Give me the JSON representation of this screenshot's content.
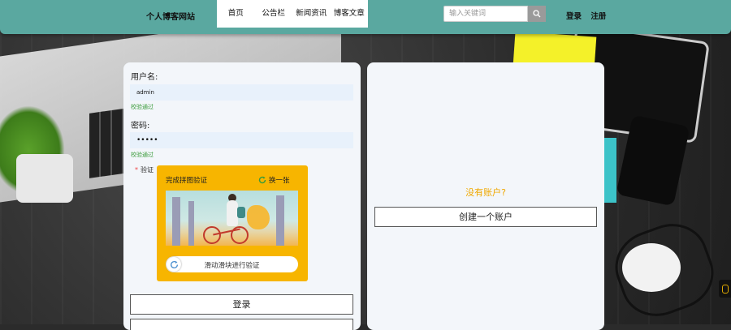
{
  "header": {
    "brand": "个人博客网站",
    "nav": [
      "首页",
      "公告栏",
      "新闻资讯",
      "博客文章"
    ],
    "search": {
      "placeholder": "输入关键词",
      "value": ""
    },
    "auth": {
      "login": "登录",
      "register": "注册"
    }
  },
  "login_form": {
    "username_label": "用户名:",
    "username_value": "admin",
    "username_hint": "校验通过",
    "password_label": "密码:",
    "password_value": "•••••",
    "password_hint": "校验通过",
    "verify_required_mark": "*",
    "verify_label": "验证",
    "captcha": {
      "title": "完成拼图验证",
      "refresh_label": "换一张",
      "slider_text": "滑动滑块进行验证"
    },
    "login_button": "登录"
  },
  "register_panel": {
    "prompt": "没有账户?",
    "create_button": "创建一个账户"
  },
  "colors": {
    "header": "#5aa8a0",
    "captcha_bg": "#f7b500",
    "hint_green": "#3a9b3a",
    "prompt_orange": "#f0a800"
  }
}
